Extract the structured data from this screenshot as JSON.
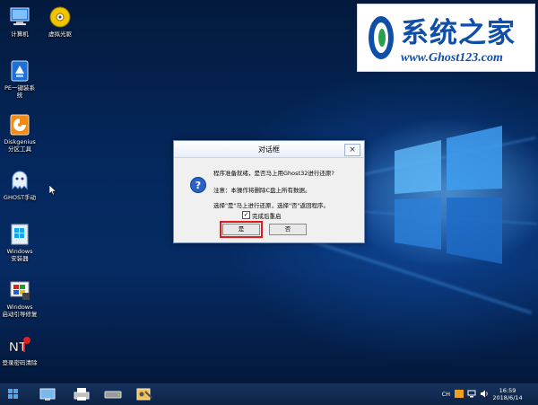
{
  "desktop_icons": [
    {
      "id": "computer",
      "label": "计算机",
      "icon": "computer-icon"
    },
    {
      "id": "virtual-drive",
      "label": "虚拟光驱",
      "icon": "disc-icon"
    },
    {
      "id": "pe-install",
      "label": "PE一键装系\n统",
      "icon": "pe-installer-icon"
    },
    {
      "id": "diskgenius",
      "label": "Diskgenius\n分区工具",
      "icon": "diskgenius-icon"
    },
    {
      "id": "ghost",
      "label": "GHOST手动",
      "icon": "ghost-icon"
    },
    {
      "id": "windows-installer",
      "label": "Windows\n安装器",
      "icon": "windows-installer-icon"
    },
    {
      "id": "boot-repair",
      "label": "Windows\n启动引导修复",
      "icon": "boot-repair-icon"
    },
    {
      "id": "password-clear",
      "label": "登录密码清除",
      "icon": "nt-password-icon"
    }
  ],
  "watermark": {
    "title": "系统之家",
    "url": "www.Ghost123.com"
  },
  "dialog": {
    "title": "对话框",
    "close_glyph": "×",
    "message_lines": [
      "程序准备就绪，是否马上用Ghost32进行还原?",
      "注意：本操作将删除C盘上所有数据。",
      "选择\"是\"马上进行还原，选择\"否\"返回程序。"
    ],
    "checkbox": {
      "label": "完成后重启",
      "checked": true
    },
    "yes_label": "是",
    "no_label": "否"
  },
  "taskbar": {
    "items": [
      "start-button",
      "network-app-icon",
      "printer-app-icon",
      "drive-app-icon",
      "tools-app-icon"
    ],
    "tray": {
      "ime": "CH",
      "time": "16:59",
      "date": "2018/6/14"
    }
  },
  "colors": {
    "highlight": "#e01b1b",
    "brand_blue": "#0f4fa8"
  }
}
